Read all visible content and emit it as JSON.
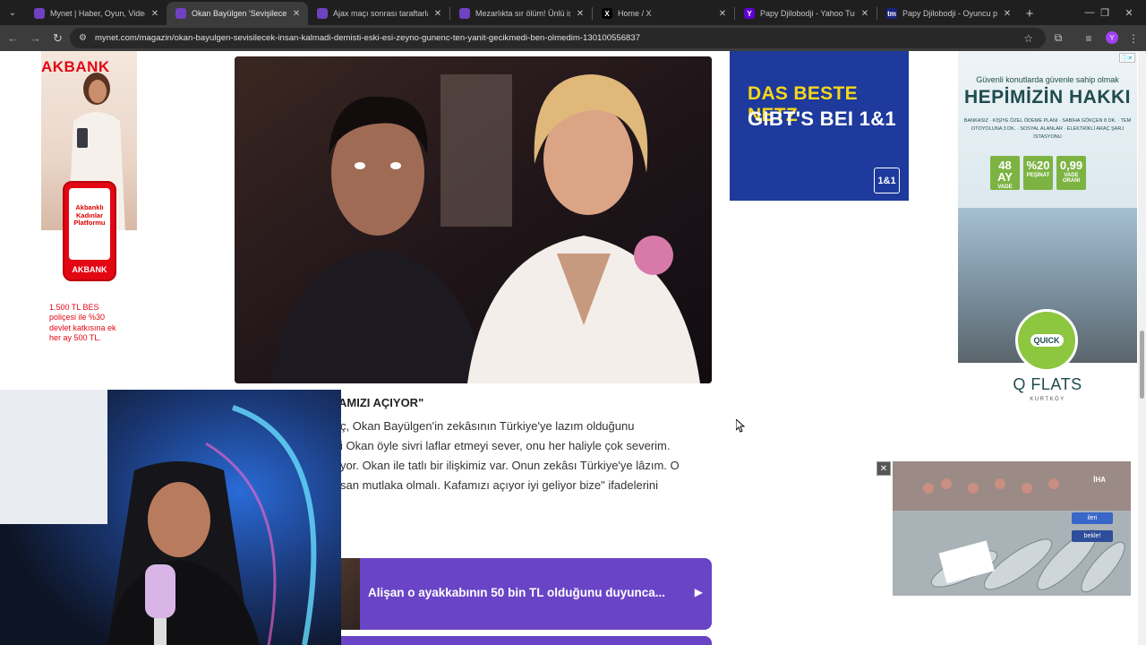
{
  "browser": {
    "tabs": [
      {
        "title": "Mynet | Haber, Oyun, Video, Sp",
        "favicon_color": "#6f42c1",
        "favicon": "",
        "active": false
      },
      {
        "title": "Okan Bayülgen 'Sevişilecek insa",
        "favicon_color": "#6f42c1",
        "favicon": "",
        "active": true
      },
      {
        "title": "Ajax maçı sonrası taraftarlar Ok",
        "favicon_color": "#6f42c1",
        "favicon": "",
        "active": false
      },
      {
        "title": "Mezarlıkta sır ölüm! Ünlü iş insa",
        "favicon_color": "#6f42c1",
        "favicon": "",
        "active": false
      },
      {
        "title": "Home / X",
        "favicon_color": "#000000",
        "favicon": "X",
        "active": false
      },
      {
        "title": "Papy Djilobodji - Yahoo Turkey",
        "favicon_color": "#6001d2",
        "favicon": "Y",
        "active": false
      },
      {
        "title": "Papy Djilobodji - Oyuncu profil",
        "favicon_color": "#1a237e",
        "favicon": "tm",
        "active": false
      }
    ],
    "url": "mynet.com/magazin/okan-bayulgen-sevisilecek-insan-kalmadi-demisti-eski-esi-zeyno-gunenc-ten-yanit-gecikmedi-ben-olmedim-130100556837",
    "profile_initial": "Y"
  },
  "ads": {
    "akbank": {
      "logo": "AKBANK",
      "phone_text": "Akbanklı Kadınlar Platformu",
      "phone_brand": "AKBANK",
      "promo": "1.500 TL BES poliçesi ile %30 devlet katkısına ek her ay 500 TL."
    },
    "one_and_one": {
      "line1": "DAS BESTE NETZ",
      "line2": "GIBT'S BEI 1&1",
      "logo": "1&1"
    },
    "flats": {
      "tagline": "Güvenli konutlarda güvenle sahip olmak",
      "headline": "HEPİMİZİN HAKKI",
      "features": "BANKASIZ · KİŞİYE ÖZEL ÖDEME PLANI · SABİHA GÖKÇEN 8 DK. · TEM OTOYOLUNA 3 DK. · SOSYAL ALANLAR · ELEKTRİKLİ ARAÇ ŞARJ İSTASYONU",
      "badges": [
        {
          "big": "48 AY",
          "small": "VADE"
        },
        {
          "big": "%20",
          "small": "PEŞİNAT"
        },
        {
          "big": "0,99",
          "small": "VADE ORANI"
        }
      ],
      "seal": "QUICK",
      "brand": "Q FLATS",
      "sub": "KURTKÖY"
    },
    "video": {
      "watermark": "İHA",
      "next_label": "ileri",
      "wait_label": "bekle!"
    }
  },
  "article": {
    "quote_heading": "AMIZI AÇIYOR\"",
    "paragraph_lines": [
      "ç, Okan Bayülgen'in zekâsının Türkiye'ye lazım olduğunu",
      "i Okan öyle sivri laflar etmeyi sever, onu her haliyle çok severim.",
      "yor. Okan ile tatlı bir ilişkimiz var. Onun zekâsı Türkiye'ye lâzım. O",
      "san mutlaka olmalı. Kafamızı açıyor iyi geliyor bize\" ifadelerini"
    ],
    "related": {
      "title": "Alişan o ayakkabının 50 bin TL olduğunu duyunca..."
    }
  },
  "colors": {
    "accent": "#6a44c6",
    "akbank_red": "#e30613",
    "brand_1und1": "#1d3a9c",
    "flats_green": "#7cb342"
  }
}
